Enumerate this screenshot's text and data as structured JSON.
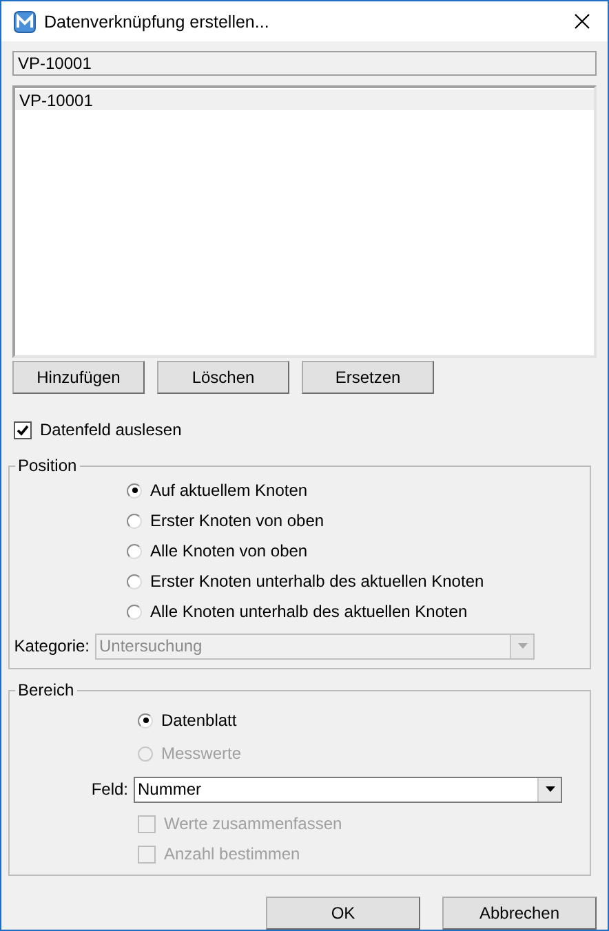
{
  "window": {
    "title": "Datenverknüpfung erstellen..."
  },
  "source_field": {
    "value": "VP-10001"
  },
  "list": {
    "items": [
      {
        "label": "VP-10001",
        "selected": true
      }
    ]
  },
  "list_buttons": [
    "Hinzufügen",
    "Löschen",
    "Ersetzen"
  ],
  "read_datafield": {
    "label": "Datenfeld auslesen",
    "checked": true
  },
  "position": {
    "title": "Position",
    "options": [
      {
        "label": "Auf aktuellem Knoten",
        "selected": true,
        "disabled": false
      },
      {
        "label": "Erster Knoten von oben",
        "selected": false,
        "disabled": false
      },
      {
        "label": "Alle Knoten von oben",
        "selected": false,
        "disabled": false
      },
      {
        "label": "Erster Knoten unterhalb des aktuellen Knoten",
        "selected": false,
        "disabled": false
      },
      {
        "label": "Alle Knoten unterhalb des aktuellen Knoten",
        "selected": false,
        "disabled": false
      }
    ],
    "category": {
      "label": "Kategorie:",
      "value": "Untersuchung",
      "disabled": true
    }
  },
  "range": {
    "title": "Bereich",
    "options": [
      {
        "label": "Datenblatt",
        "selected": true,
        "disabled": false
      },
      {
        "label": "Messwerte",
        "selected": false,
        "disabled": true
      }
    ],
    "field": {
      "label": "Feld:",
      "value": "Nummer",
      "disabled": false
    },
    "checks": [
      {
        "label": "Werte zusammenfassen",
        "checked": false,
        "disabled": true
      },
      {
        "label": "Anzahl bestimmen",
        "checked": false,
        "disabled": true
      }
    ]
  },
  "buttons": [
    "OK",
    "Abbrechen"
  ]
}
